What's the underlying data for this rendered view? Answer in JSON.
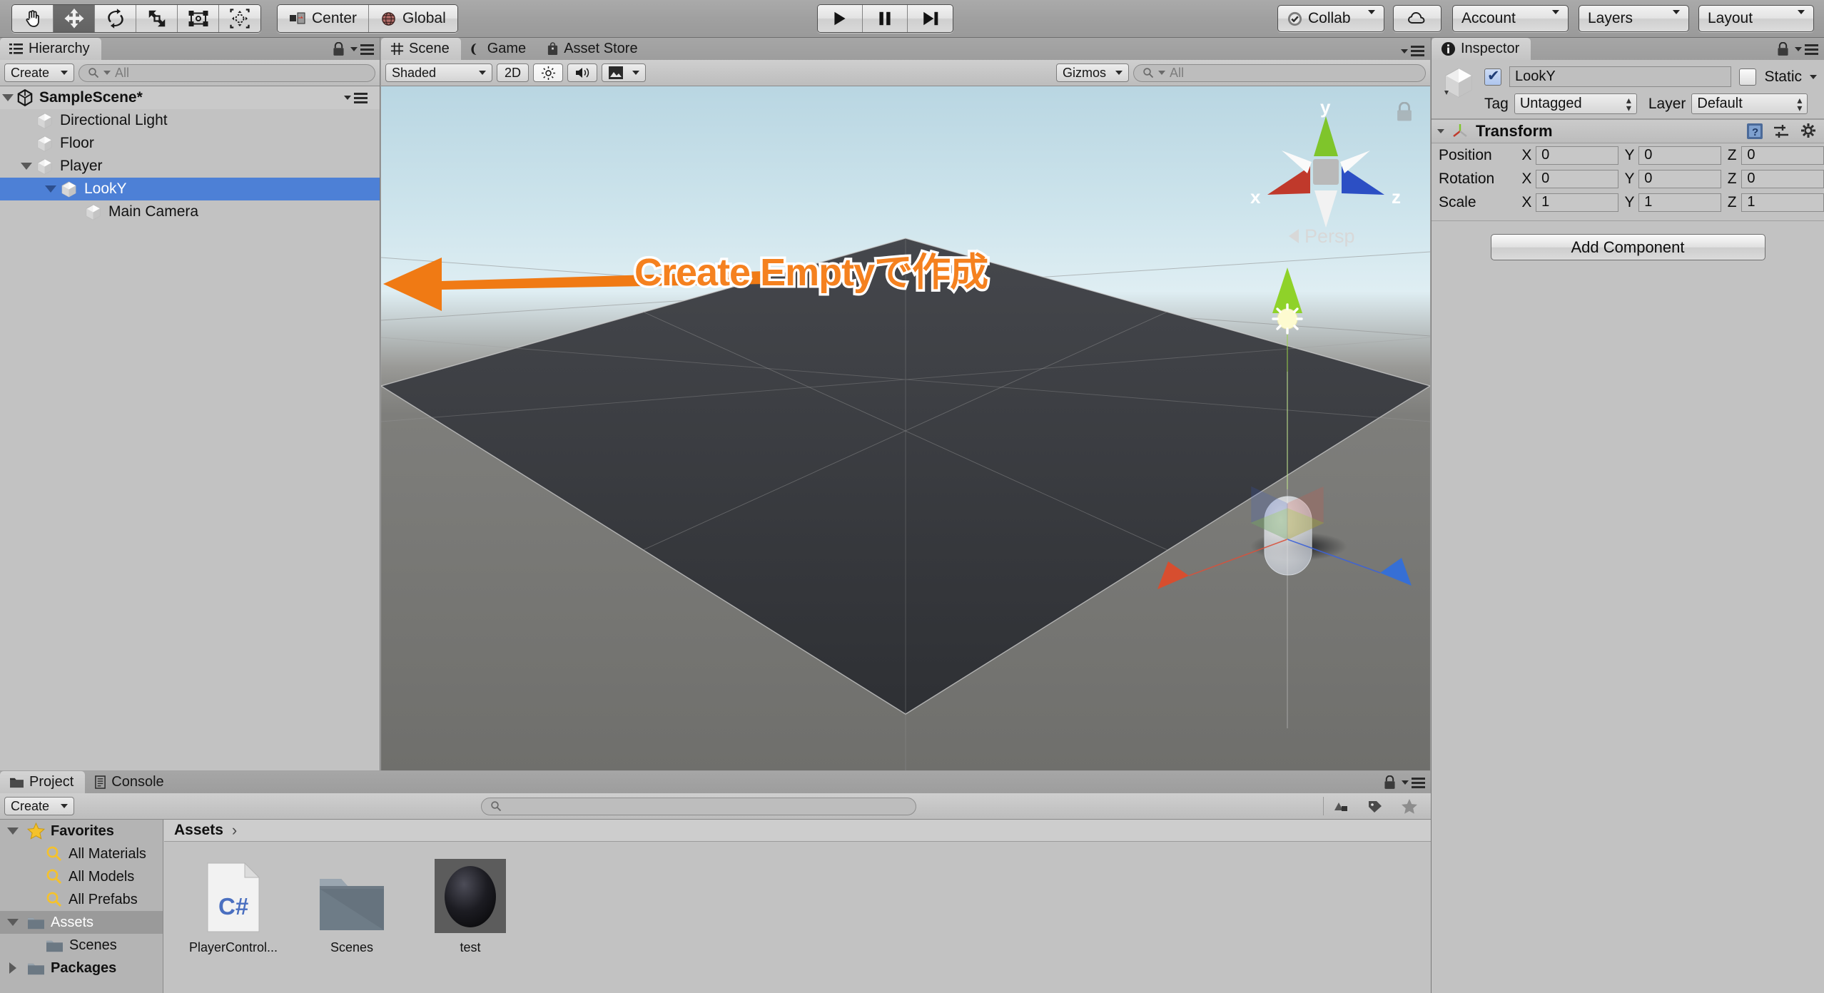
{
  "toolbar": {
    "tools": [
      {
        "name": "hand-tool",
        "label": "Hand"
      },
      {
        "name": "move-tool",
        "label": "Move"
      },
      {
        "name": "rotate-tool",
        "label": "Rotate"
      },
      {
        "name": "scale-tool",
        "label": "Scale"
      },
      {
        "name": "rect-tool",
        "label": "Rect"
      },
      {
        "name": "transform-tool",
        "label": "Transform"
      }
    ],
    "pivot": "Center",
    "space": "Global",
    "play": "Play",
    "pause": "Pause",
    "step": "Step",
    "collab": "Collab",
    "cloud": "Cloud",
    "account": "Account",
    "layers": "Layers",
    "layout": "Layout"
  },
  "hierarchy": {
    "tab": "Hierarchy",
    "create": "Create",
    "search_placeholder": "All",
    "scene_name": "SampleScene*",
    "items": [
      {
        "label": "Directional Light",
        "depth": 1,
        "expandable": false,
        "selected": false
      },
      {
        "label": "Floor",
        "depth": 1,
        "expandable": false,
        "selected": false
      },
      {
        "label": "Player",
        "depth": 1,
        "expandable": true,
        "selected": false
      },
      {
        "label": "LookY",
        "depth": 2,
        "expandable": true,
        "selected": true
      },
      {
        "label": "Main Camera",
        "depth": 3,
        "expandable": false,
        "selected": false
      }
    ]
  },
  "scene": {
    "tabs": [
      {
        "label": "Scene",
        "selected": true
      },
      {
        "label": "Game",
        "selected": false
      },
      {
        "label": "Asset Store",
        "selected": false
      }
    ],
    "draw_mode": "Shaded",
    "mode_2d": "2D",
    "gizmos": "Gizmos",
    "search_placeholder": "All",
    "axis_x": "x",
    "axis_y": "y",
    "axis_z": "z",
    "perspective_label": "Persp",
    "annotation": "Create Emptyで作成"
  },
  "inspector": {
    "tab": "Inspector",
    "object_name": "LookY",
    "enabled": true,
    "static_label": "Static",
    "tag_label": "Tag",
    "tag_value": "Untagged",
    "layer_label": "Layer",
    "layer_value": "Default",
    "component": "Transform",
    "transform": {
      "rows": [
        {
          "label": "Position",
          "x": "0",
          "y": "0",
          "z": "0"
        },
        {
          "label": "Rotation",
          "x": "0",
          "y": "0",
          "z": "0"
        },
        {
          "label": "Scale",
          "x": "1",
          "y": "1",
          "z": "1"
        }
      ],
      "axis_labels": [
        "X",
        "Y",
        "Z"
      ]
    },
    "add_component": "Add Component"
  },
  "project": {
    "tabs": [
      {
        "label": "Project",
        "selected": true
      },
      {
        "label": "Console",
        "selected": false
      }
    ],
    "create": "Create",
    "search_placeholder": "",
    "tree": [
      {
        "label": "Favorites",
        "kind": "favorites",
        "depth": 0,
        "expanded": true,
        "selected": false
      },
      {
        "label": "All Materials",
        "kind": "search",
        "depth": 1,
        "expanded": false,
        "selected": false
      },
      {
        "label": "All Models",
        "kind": "search",
        "depth": 1,
        "expanded": false,
        "selected": false
      },
      {
        "label": "All Prefabs",
        "kind": "search",
        "depth": 1,
        "expanded": false,
        "selected": false
      },
      {
        "label": "Assets",
        "kind": "folder",
        "depth": 0,
        "expanded": true,
        "selected": true
      },
      {
        "label": "Scenes",
        "kind": "folder",
        "depth": 1,
        "expanded": false,
        "selected": false
      },
      {
        "label": "Packages",
        "kind": "folder",
        "depth": 0,
        "expanded": false,
        "selected": false
      }
    ],
    "breadcrumb": "Assets",
    "assets": [
      {
        "label": "PlayerControl...",
        "kind": "csharp"
      },
      {
        "label": "Scenes",
        "kind": "folder"
      },
      {
        "label": "test",
        "kind": "material"
      }
    ]
  },
  "colors": {
    "selection_blue": "#4d80d6",
    "annotation_orange": "#f5811f",
    "arrow_orange": "#f07a14",
    "panel_gray": "#c2c2c2",
    "toolbar_gray": "#a2a2a2"
  }
}
